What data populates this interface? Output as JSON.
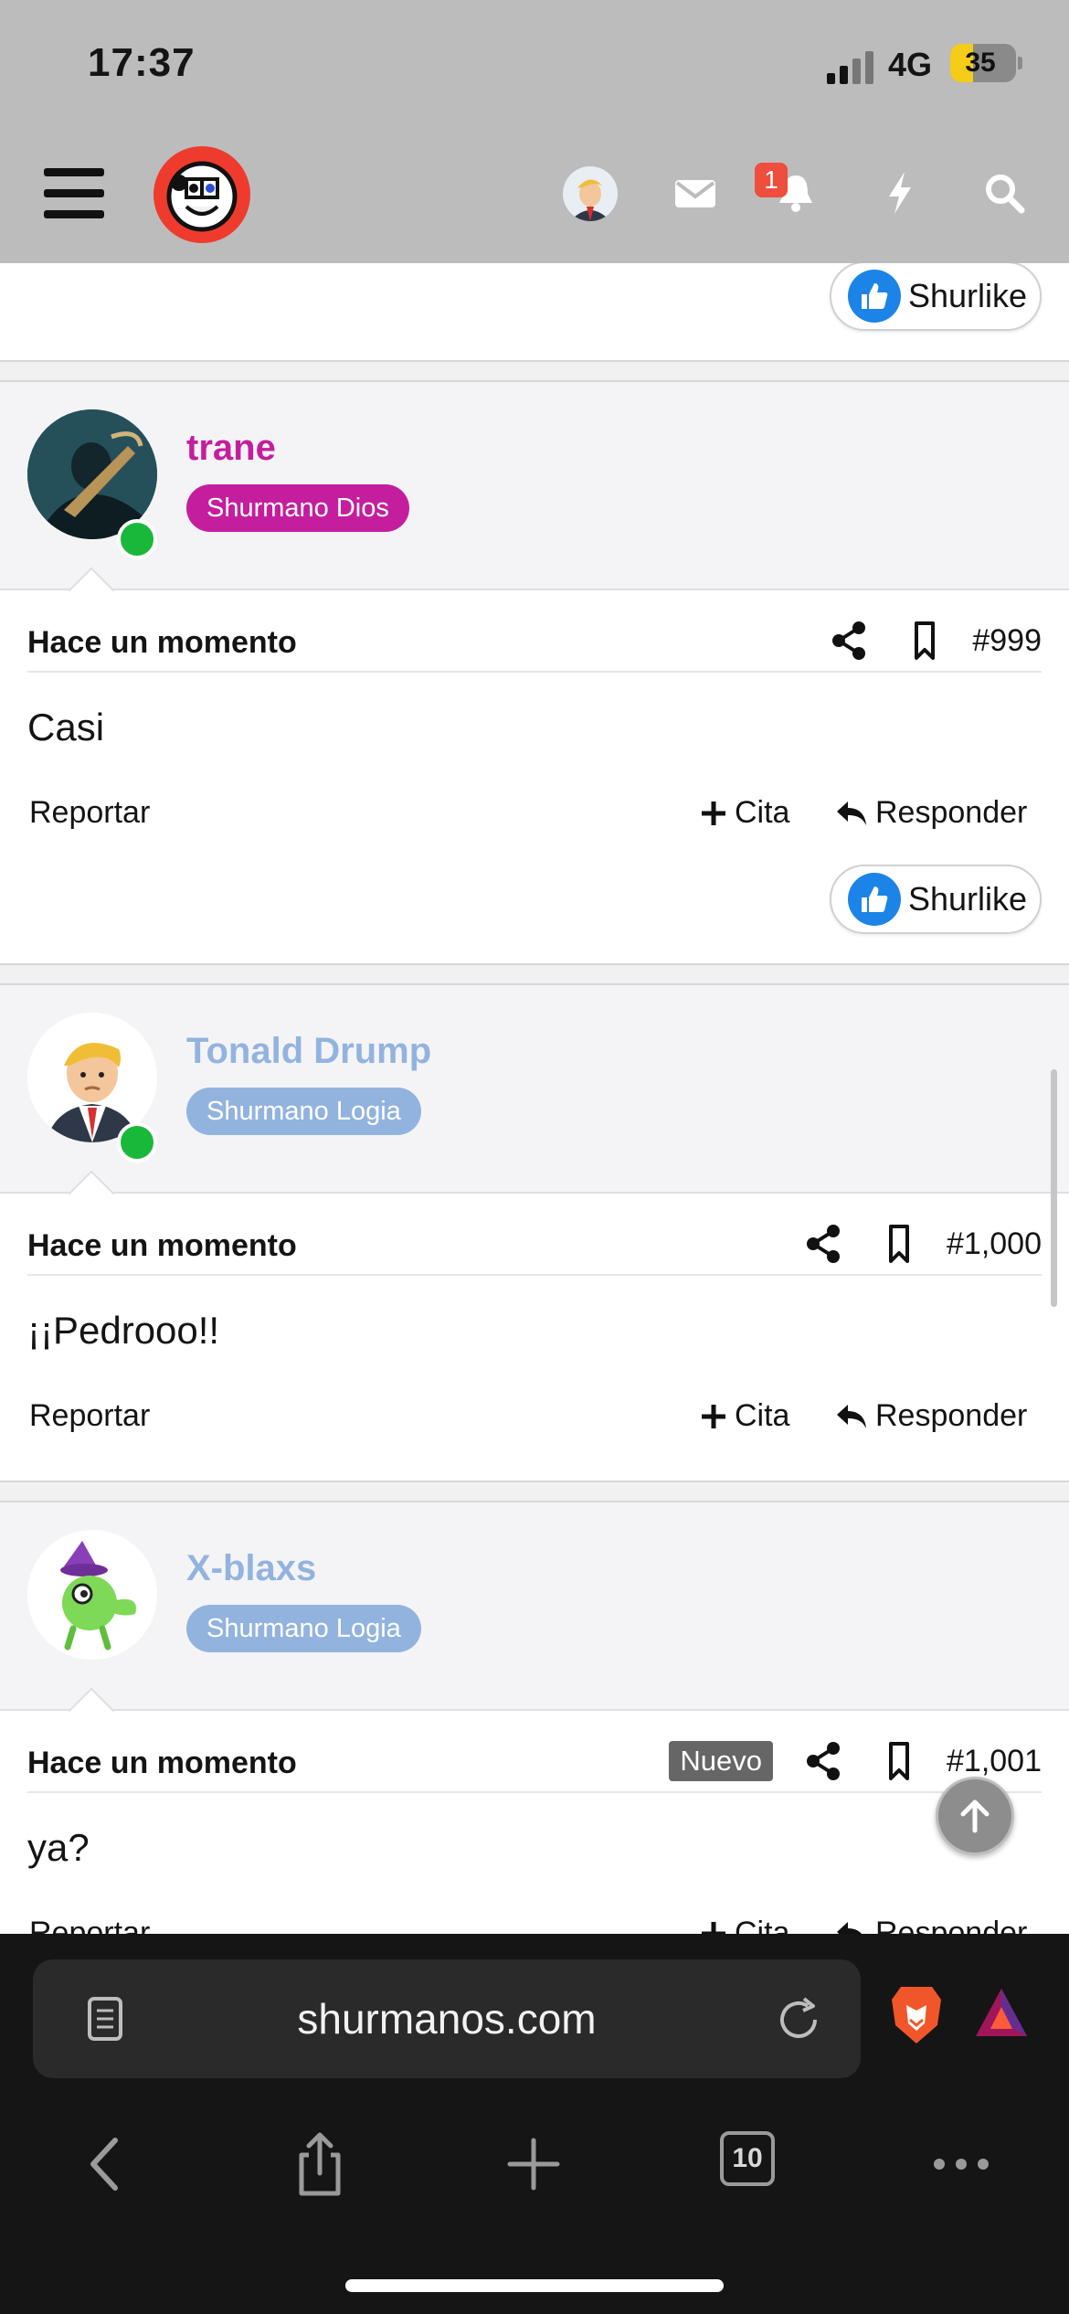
{
  "status_bar": {
    "time": "17:37",
    "network": "4G",
    "battery": "35",
    "battery_level": 0.35
  },
  "header": {
    "notification_count": "1"
  },
  "posts": [
    {
      "username": "trane",
      "username_color": "#c41e9e",
      "rank": "Shurmano Dios",
      "rank_color": "#c41e9e",
      "time": "Hace un momento",
      "number": "#999",
      "body": "Casi",
      "report": "Reportar",
      "quote": "Cita",
      "reply": "Responder",
      "like": "Shurlike",
      "online": true
    },
    {
      "username": "Tonald Drump",
      "username_color": "#93b3df",
      "rank": "Shurmano Logia",
      "rank_color": "#93b3df",
      "time": "Hace un momento",
      "number": "#1,000",
      "body": "¡¡Pedrooo!!",
      "report": "Reportar",
      "quote": "Cita",
      "reply": "Responder",
      "online": true
    },
    {
      "username": "X-blaxs",
      "username_color": "#93b3df",
      "rank": "Shurmano Logia",
      "rank_color": "#93b3df",
      "time": "Hace un momento",
      "badge": "Nuevo",
      "number": "#1,001",
      "body": "ya?",
      "report": "Reportar",
      "quote": "Cita",
      "reply": "Responder"
    }
  ],
  "previous_post": {
    "like": "Shurlike"
  },
  "browser": {
    "url": "shurmanos.com",
    "tabs_count": "10"
  },
  "icons": [
    "menu-icon",
    "site-logo",
    "envelope-icon",
    "bell-icon",
    "lightning-icon",
    "search-icon",
    "share-icon",
    "bookmark-icon",
    "plus-icon",
    "reply-icon",
    "thumbs-up-icon",
    "arrow-up-icon",
    "reader-icon",
    "reload-icon",
    "brave-lion-icon",
    "brave-rewards-icon",
    "back-icon",
    "share-sheet-icon",
    "new-tab-icon",
    "more-icon"
  ]
}
